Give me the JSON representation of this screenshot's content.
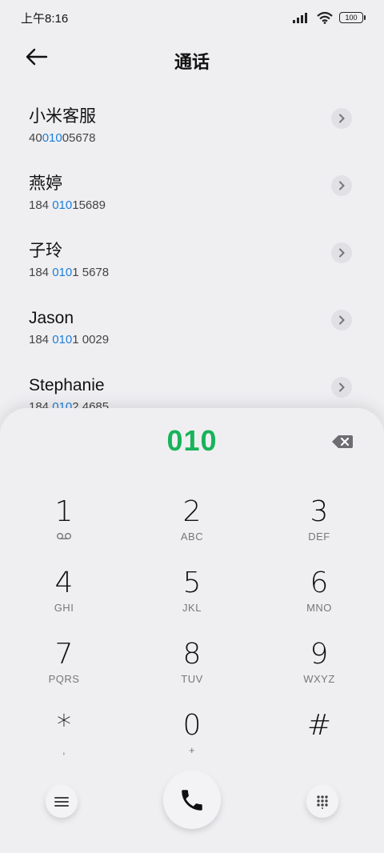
{
  "status_bar": {
    "time": "上午8:16",
    "battery": "100"
  },
  "header": {
    "title": "通话"
  },
  "contacts": [
    {
      "name": "小米客服",
      "number_pre": "40",
      "number_match": "010",
      "number_post": "05678"
    },
    {
      "name": "燕婷",
      "number_pre": "184 ",
      "number_match": "010",
      "number_post": "15689"
    },
    {
      "name": "子玲",
      "number_pre": "184 ",
      "number_match": "010",
      "number_post": "1 5678"
    },
    {
      "name": "Jason",
      "number_pre": "184 ",
      "number_match": "010",
      "number_post": "1 0029"
    },
    {
      "name": "Stephanie",
      "number_pre": "184 ",
      "number_match": "010",
      "number_post": "2 4685"
    }
  ],
  "dialpad": {
    "dialed_number": "010",
    "keys": [
      {
        "digit": "1",
        "letters": ""
      },
      {
        "digit": "2",
        "letters": "ABC"
      },
      {
        "digit": "3",
        "letters": "DEF"
      },
      {
        "digit": "4",
        "letters": "GHI"
      },
      {
        "digit": "5",
        "letters": "JKL"
      },
      {
        "digit": "6",
        "letters": "MNO"
      },
      {
        "digit": "7",
        "letters": "PQRS"
      },
      {
        "digit": "8",
        "letters": "TUV"
      },
      {
        "digit": "9",
        "letters": "WXYZ"
      },
      {
        "digit": "*",
        "letters": ","
      },
      {
        "digit": "0",
        "letters": "+"
      },
      {
        "digit": "#",
        "letters": ""
      }
    ]
  },
  "icons": {
    "back": "arrow-left-icon",
    "chevron": "chevron-right-icon",
    "backspace": "backspace-icon",
    "voicemail": "voicemail-icon",
    "menu": "menu-icon",
    "call": "phone-icon",
    "keypad": "keypad-grid-icon"
  },
  "colors": {
    "accent_green": "#18b35a",
    "match_blue": "#1d7ed9",
    "background": "#efeff2"
  }
}
